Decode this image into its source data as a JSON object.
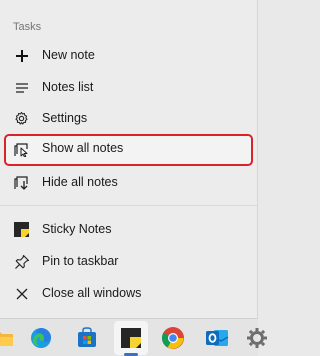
{
  "jump_list": {
    "section_header": "Tasks",
    "tasks": [
      {
        "label": "New note",
        "icon": "plus-icon"
      },
      {
        "label": "Notes list",
        "icon": "list-icon"
      },
      {
        "label": "Settings",
        "icon": "gear-icon"
      },
      {
        "label": "Show all notes",
        "icon": "show-notes-icon",
        "highlighted": true
      },
      {
        "label": "Hide all notes",
        "icon": "hide-notes-icon"
      }
    ],
    "app_items": [
      {
        "label": "Sticky Notes",
        "icon": "sticky-notes-app-icon"
      },
      {
        "label": "Pin to taskbar",
        "icon": "pin-icon"
      },
      {
        "label": "Close all windows",
        "icon": "close-icon"
      }
    ]
  },
  "taskbar": {
    "icons": [
      "file-explorer-icon",
      "edge-icon",
      "microsoft-store-icon",
      "sticky-notes-icon",
      "chrome-icon",
      "outlook-icon",
      "settings-icon"
    ],
    "active_app": "Sticky Notes"
  },
  "colors": {
    "highlight_border": "#d9222a",
    "background": "#ececec",
    "sticky_yellow": "#f7d331"
  }
}
